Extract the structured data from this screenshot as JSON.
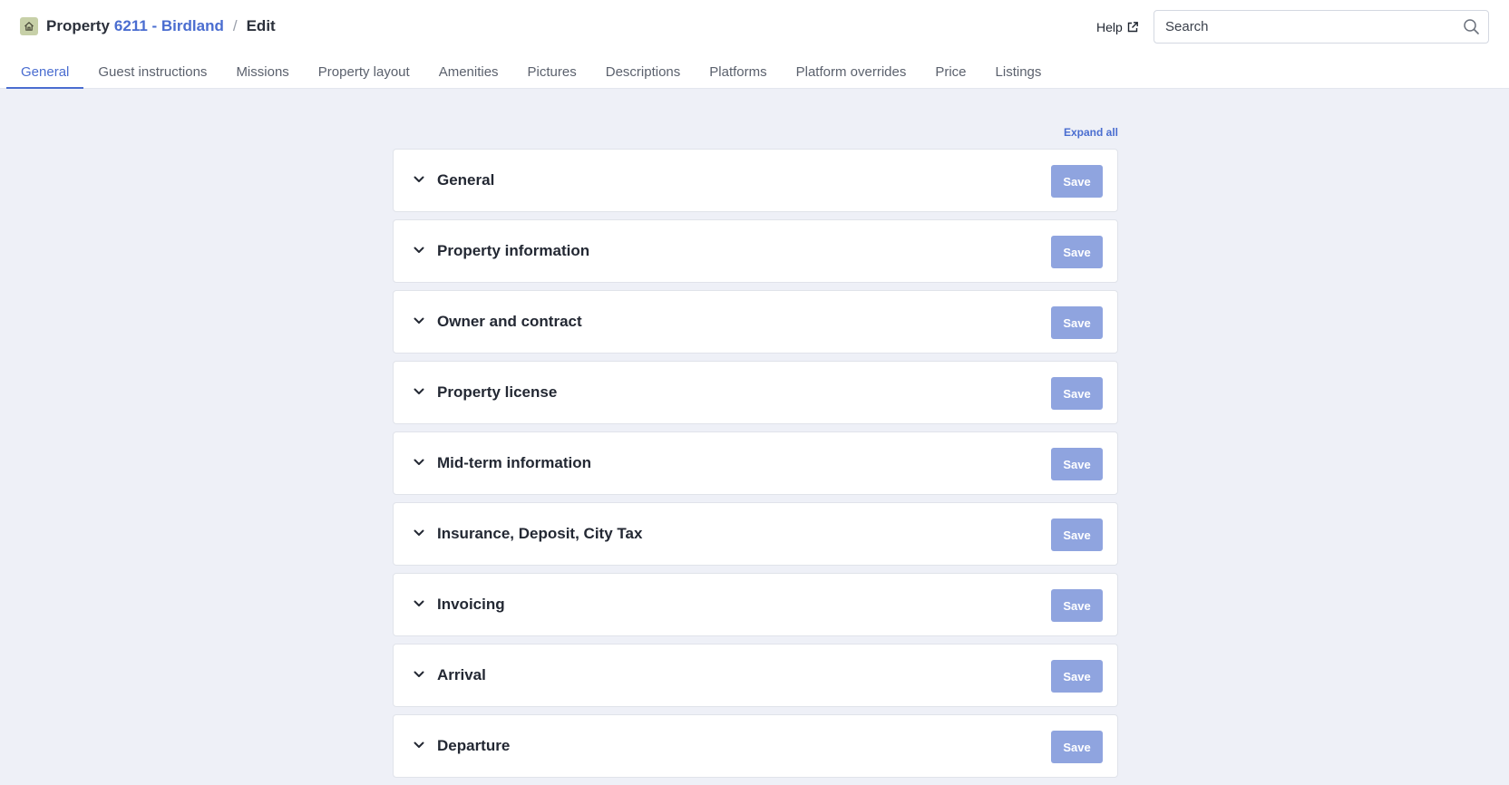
{
  "header": {
    "breadcrumb": {
      "label": "Property",
      "link": "6211 - Birdland",
      "separator": "/",
      "current": "Edit"
    },
    "help_label": "Help",
    "search": {
      "placeholder": "Search",
      "value": ""
    }
  },
  "tabs": [
    {
      "label": "General",
      "active": true
    },
    {
      "label": "Guest instructions"
    },
    {
      "label": "Missions"
    },
    {
      "label": "Property layout"
    },
    {
      "label": "Amenities"
    },
    {
      "label": "Pictures"
    },
    {
      "label": "Descriptions"
    },
    {
      "label": "Platforms"
    },
    {
      "label": "Platform overrides"
    },
    {
      "label": "Price"
    },
    {
      "label": "Listings"
    }
  ],
  "main": {
    "expand_all_label": "Expand all",
    "save_label": "Save",
    "sections": [
      {
        "title": "General"
      },
      {
        "title": "Property information"
      },
      {
        "title": "Owner and contract"
      },
      {
        "title": "Property license"
      },
      {
        "title": "Mid-term information"
      },
      {
        "title": "Insurance, Deposit, City Tax"
      },
      {
        "title": "Invoicing"
      },
      {
        "title": "Arrival"
      },
      {
        "title": "Departure"
      }
    ]
  },
  "colors": {
    "accent": "#4a6dd0",
    "save_button": "#8fa4df",
    "page_background": "#eef0f7",
    "home_badge": "#c7d0a8"
  },
  "icons": {
    "home": "home-icon",
    "external_link": "external-link-icon",
    "search": "search-icon",
    "chevron": "chevron-down-icon"
  }
}
